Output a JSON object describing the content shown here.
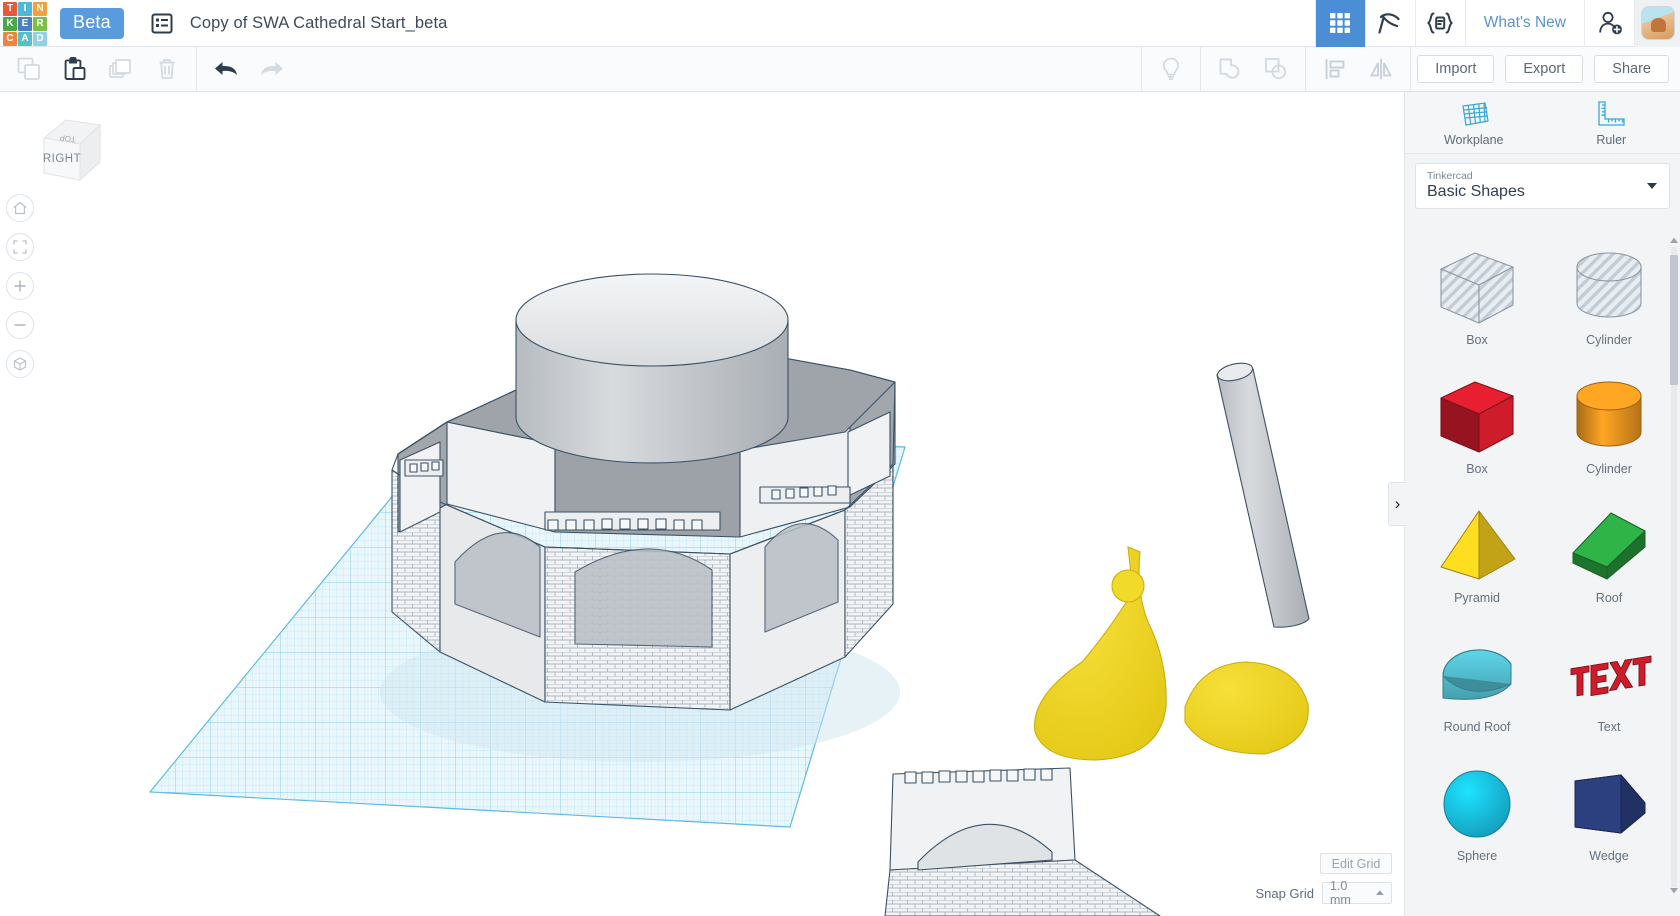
{
  "header": {
    "logo_letters": [
      {
        "ch": "T",
        "color": "#e8583a"
      },
      {
        "ch": "I",
        "color": "#4fb8d9"
      },
      {
        "ch": "N",
        "color": "#f3a13c"
      },
      {
        "ch": "K",
        "color": "#4aa84a"
      },
      {
        "ch": "E",
        "color": "#4a7fc1"
      },
      {
        "ch": "R",
        "color": "#7bbf47"
      },
      {
        "ch": "C",
        "color": "#f0843a"
      },
      {
        "ch": "A",
        "color": "#56c0c8"
      },
      {
        "ch": "D",
        "color": "#8fd0ea"
      }
    ],
    "beta_label": "Beta",
    "list_icon": "list-icon",
    "document_title": "Copy of SWA Cathedral Start_beta",
    "right_icons": [
      {
        "name": "design-grid-icon",
        "active": true
      },
      {
        "name": "codeblocks-pickaxe-icon",
        "active": false
      },
      {
        "name": "codeblocks-brackets-icon",
        "active": false
      }
    ],
    "whats_new_label": "What's New",
    "invite_icon": "add-person-icon",
    "avatar_name": "user-avatar"
  },
  "toolbar": {
    "left_tools": [
      {
        "name": "copy-button",
        "label": "Copy",
        "enabled": false
      },
      {
        "name": "paste-button",
        "label": "Paste",
        "enabled": true
      },
      {
        "name": "duplicate-button",
        "label": "Duplicate",
        "enabled": false
      },
      {
        "name": "delete-button",
        "label": "Delete",
        "enabled": false
      }
    ],
    "history_tools": [
      {
        "name": "undo-button",
        "label": "Undo",
        "enabled": true
      },
      {
        "name": "redo-button",
        "label": "Redo",
        "enabled": false
      }
    ],
    "right_tools": [
      {
        "name": "notes-button",
        "label": "Notes",
        "enabled": false
      },
      {
        "name": "group-button",
        "label": "Group",
        "enabled": false
      },
      {
        "name": "ungroup-button",
        "label": "Ungroup",
        "enabled": false
      },
      {
        "name": "align-button",
        "label": "Align",
        "enabled": false
      },
      {
        "name": "mirror-button",
        "label": "Mirror",
        "enabled": false
      }
    ],
    "import_label": "Import",
    "export_label": "Export",
    "share_label": "Share"
  },
  "canvas": {
    "view_cube": {
      "front_face": "RIGHT",
      "top_face": "TOP"
    },
    "nav_buttons": [
      {
        "name": "home-view-button",
        "icon": "home-icon"
      },
      {
        "name": "fit-view-button",
        "icon": "fit-frame-icon"
      },
      {
        "name": "zoom-in-button",
        "icon": "plus-icon"
      },
      {
        "name": "zoom-out-button",
        "icon": "minus-icon"
      },
      {
        "name": "perspective-toggle-button",
        "icon": "cube-perspective-icon"
      }
    ],
    "edit_grid_label": "Edit Grid",
    "snap_grid_label": "Snap Grid",
    "snap_grid_value": "1.0 mm"
  },
  "panel": {
    "collapse_icon": "›",
    "workplane_label": "Workplane",
    "ruler_label": "Ruler",
    "library_owner": "Tinkercad",
    "library_name": "Basic Shapes",
    "shapes": [
      {
        "label": "Box",
        "art": "box-hollow",
        "color": "#c8d2da"
      },
      {
        "label": "Cylinder",
        "art": "cylinder-hollow",
        "color": "#c8d2da"
      },
      {
        "label": "Box",
        "art": "box-solid",
        "color": "#cf1c2b"
      },
      {
        "label": "Cylinder",
        "art": "cylinder-solid",
        "color": "#e8941f"
      },
      {
        "label": "Pyramid",
        "art": "pyramid",
        "color": "#ecc61c"
      },
      {
        "label": "Roof",
        "art": "roof",
        "color": "#2aa13f"
      },
      {
        "label": "Round Roof",
        "art": "round-roof",
        "color": "#53bfd0"
      },
      {
        "label": "Text",
        "art": "text-shape",
        "color": "#cf1c2b"
      },
      {
        "label": "Sphere",
        "art": "sphere",
        "color": "#17b6dd"
      },
      {
        "label": "Wedge",
        "art": "wedge",
        "color": "#2c3f7f"
      }
    ]
  }
}
